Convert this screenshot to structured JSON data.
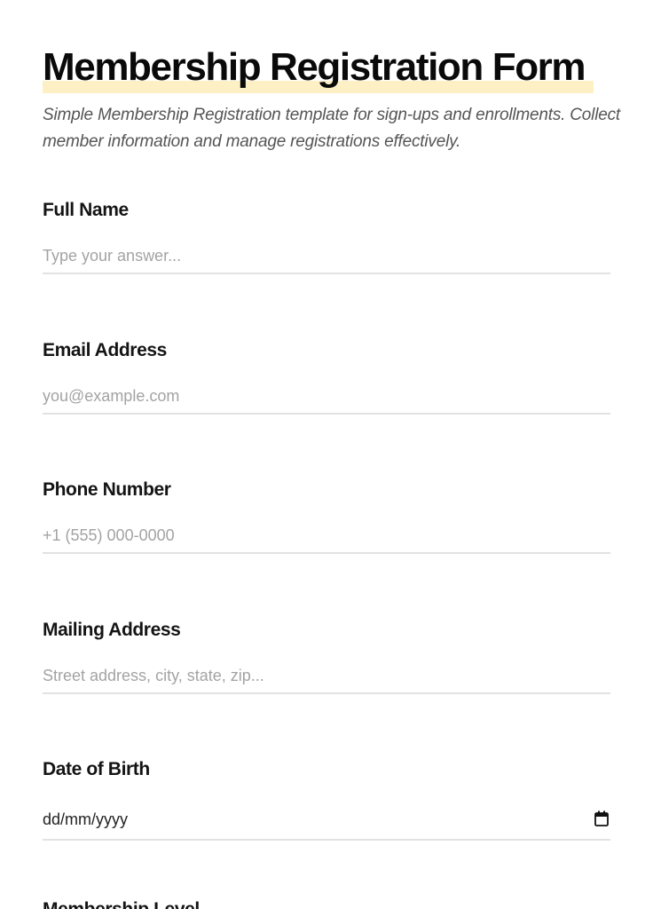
{
  "form": {
    "title": "Membership Registration Form",
    "description": "Simple Membership Registration template for sign-ups and enrollments. Collect member information and manage registrations effectively.",
    "fields": [
      {
        "label": "Full Name",
        "placeholder": "Type your answer..."
      },
      {
        "label": "Email Address",
        "placeholder": "you@example.com"
      },
      {
        "label": "Phone Number",
        "placeholder": "+1 (555) 000-0000"
      },
      {
        "label": "Mailing Address",
        "placeholder": "Street address, city, state, zip..."
      },
      {
        "label": "Date of Birth",
        "value": "dd/mm/yyyy",
        "icon": "calendar-icon"
      },
      {
        "label": "Membership Level"
      }
    ]
  },
  "colors": {
    "title_highlight": "#fdf0c4",
    "placeholder": "#a3a3a3",
    "underline": "#e2e2e2"
  }
}
